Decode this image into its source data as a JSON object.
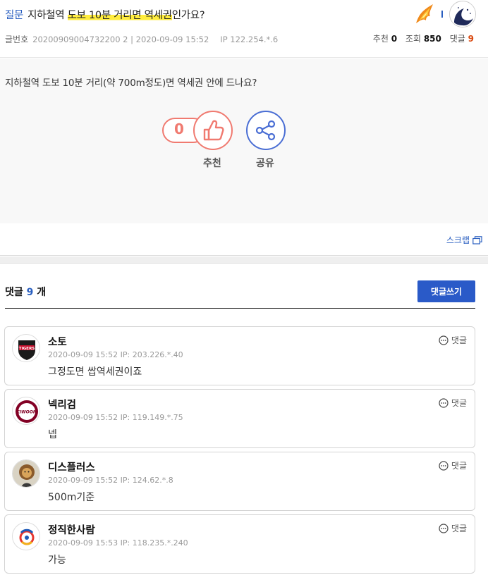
{
  "post": {
    "category": "질문",
    "title_pre": "지하철역 ",
    "title_highlight": "도보 10분 거리면 역세권",
    "title_post": "인가요?",
    "meta_label": "글번호",
    "post_no_date": "20200909004732200 2 | 2020-09-09 15:52",
    "ip": "IP 122.254.*.6",
    "recommend_label": "추천",
    "recommend_count": "0",
    "views_label": "조회",
    "views_count": "850",
    "comments_label": "댓글",
    "comments_count": "9",
    "body": "지하철역 도보 10분 거리(약 700m정도)면 역세권 안에 드나요?",
    "rec_button_count": "0",
    "rec_button_label": "추천",
    "share_button_label": "공유",
    "scrap_label": "스크랩"
  },
  "comments_section": {
    "title_pre": "댓글 ",
    "count": "9",
    "title_post": " 개",
    "write_button": "댓글쓰기"
  },
  "comments": [
    {
      "nick": "소토",
      "date": "2020-09-09 15:52",
      "ip": "IP: 203.226.*.40",
      "text": "그정도면 쌉역세권이죠",
      "reply": "댓글",
      "team": "TIGERS",
      "team_color": "#c8102e"
    },
    {
      "nick": "넥리검",
      "date": "2020-09-09 15:52",
      "ip": "IP: 119.149.*.75",
      "text": "넵",
      "reply": "댓글",
      "team": "KIWOOM",
      "team_color": "#820024"
    },
    {
      "nick": "디스플러스",
      "date": "2020-09-09 15:52",
      "ip": "IP: 124.62.*.8",
      "text": "500m기준",
      "reply": "댓글"
    },
    {
      "nick": "정직한사람",
      "date": "2020-09-09 15:53",
      "ip": "IP: 118.235.*.240",
      "text": "가능",
      "reply": "댓글"
    }
  ],
  "colors": {
    "accent_blue": "#2a5ac8",
    "recommend_red": "#f07a70",
    "highlight_yellow": "#ffec3d"
  }
}
